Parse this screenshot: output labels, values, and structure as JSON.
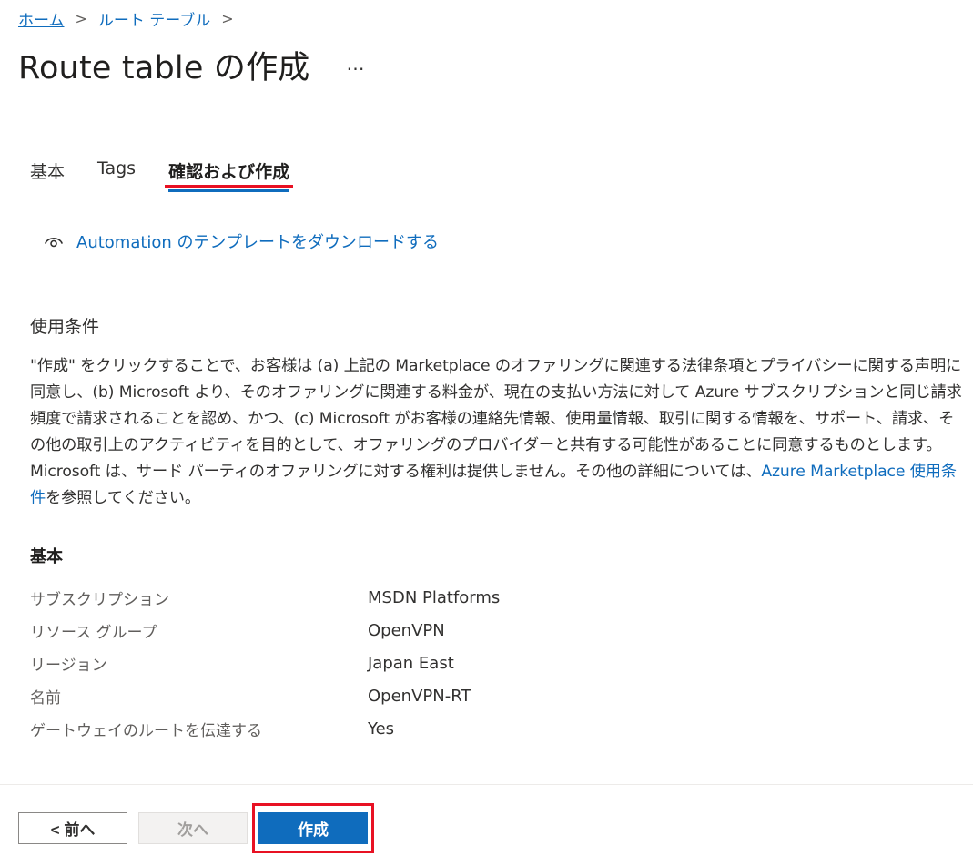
{
  "breadcrumb": {
    "items": [
      "ホーム",
      "ルート テーブル"
    ],
    "separator": ">"
  },
  "page": {
    "title": "Route table の作成",
    "more_label": "…"
  },
  "tabs": [
    {
      "label": "基本",
      "active": false
    },
    {
      "label": "Tags",
      "active": false
    },
    {
      "label": "確認および作成",
      "active": true
    }
  ],
  "automation": {
    "icon": "eye-icon",
    "label": "Automation のテンプレートをダウンロードする"
  },
  "terms": {
    "heading": "使用条件",
    "body_before_link": "\"作成\" をクリックすることで、お客様は (a) 上記の Marketplace のオファリングに関連する法律条項とプライバシーに関する声明に同意し、(b) Microsoft より、そのオファリングに関連する料金が、現在の支払い方法に対して Azure サブスクリプションと同じ請求頻度で請求されることを認め、かつ、(c) Microsoft がお客様の連絡先情報、使用量情報、取引に関する情報を、サポート、請求、その他の取引上のアクティビティを目的として、オファリングのプロバイダーと共有する可能性があることに同意するものとします。Microsoft は、サード パーティのオファリングに対する権利は提供しません。その他の詳細については、",
    "link_text": "Azure Marketplace 使用条件",
    "body_after_link": "を参照してください。"
  },
  "basics": {
    "heading": "基本",
    "rows": [
      {
        "label": "サブスクリプション",
        "value": "MSDN Platforms"
      },
      {
        "label": "リソース グループ",
        "value": "OpenVPN"
      },
      {
        "label": "リージョン",
        "value": "Japan East"
      },
      {
        "label": "名前",
        "value": "OpenVPN-RT"
      },
      {
        "label": "ゲートウェイのルートを伝達する",
        "value": "Yes"
      }
    ]
  },
  "footer": {
    "prev_label": "< 前へ",
    "next_label": "次へ",
    "create_label": "作成"
  },
  "colors": {
    "accent": "#0f6cbd",
    "highlight": "#e81123"
  }
}
